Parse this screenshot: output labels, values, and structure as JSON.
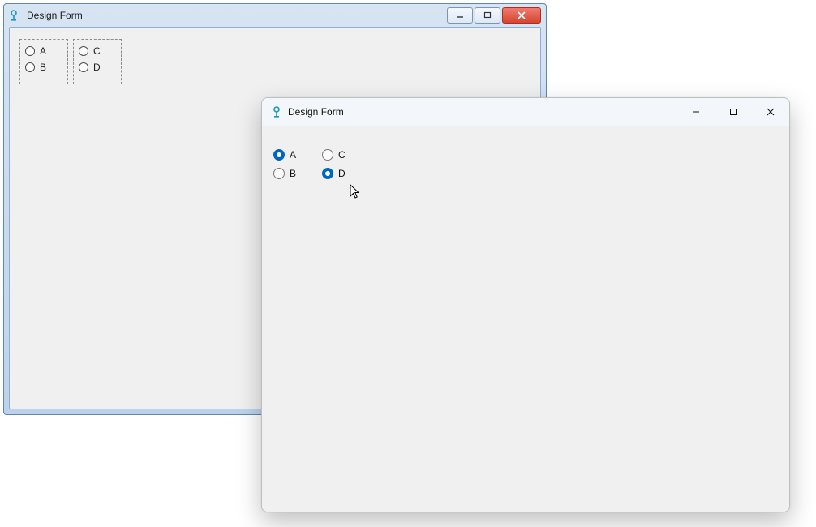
{
  "back_window": {
    "title": "Design Form",
    "group1": {
      "items": [
        {
          "label": "A"
        },
        {
          "label": "B"
        }
      ]
    },
    "group2": {
      "items": [
        {
          "label": "C"
        },
        {
          "label": "D"
        }
      ]
    }
  },
  "front_window": {
    "title": "Design Form",
    "group1": {
      "items": [
        {
          "label": "A",
          "checked": true
        },
        {
          "label": "B",
          "checked": false
        }
      ]
    },
    "group2": {
      "items": [
        {
          "label": "C",
          "checked": false
        },
        {
          "label": "D",
          "checked": true
        }
      ]
    }
  }
}
